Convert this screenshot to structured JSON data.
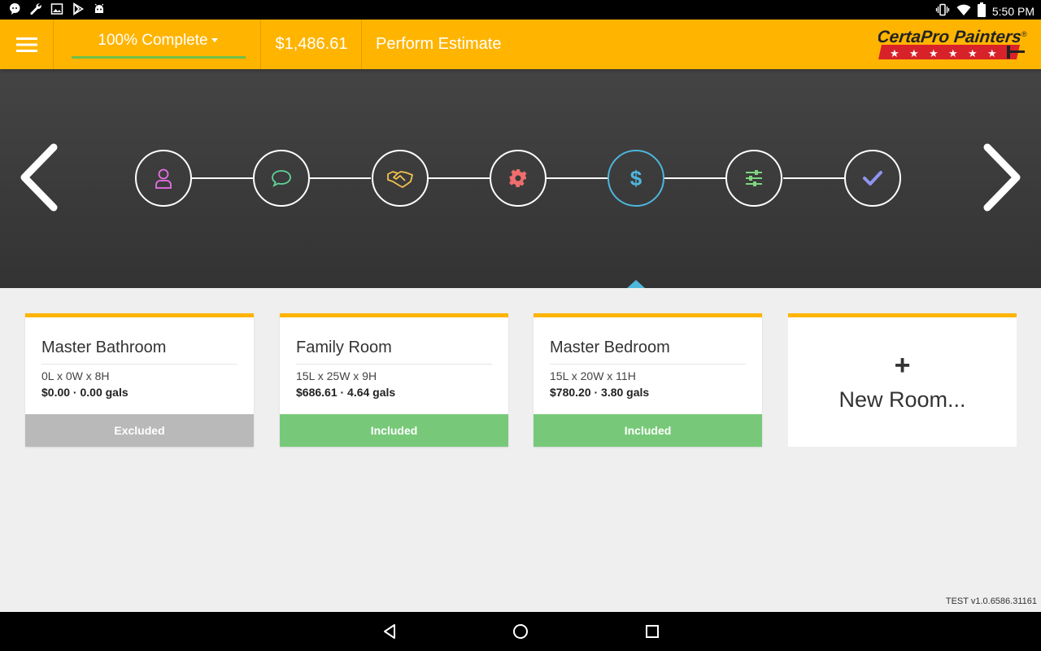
{
  "status_bar": {
    "time": "5:50 PM",
    "left_icons": [
      "chat-bubble-icon",
      "wrench-icon",
      "image-icon",
      "play-store-icon",
      "android-icon"
    ],
    "right_icons": [
      "vibrate-icon",
      "wifi-icon",
      "battery-icon"
    ]
  },
  "header": {
    "menu_icon": "hamburger-menu-icon",
    "progress_label": "100% Complete",
    "progress_fraction": 1.0,
    "total": "$1,486.61",
    "title": "Perform Estimate",
    "logo_text": "CertaPro Painters",
    "logo_mark": "®"
  },
  "stepper": {
    "prev_icon": "chevron-left-icon",
    "next_icon": "chevron-right-icon",
    "steps": [
      {
        "icon": "user-icon",
        "color": "#e86fe6"
      },
      {
        "icon": "speech-bubble-icon",
        "color": "#5fd39a"
      },
      {
        "icon": "handshake-icon",
        "color": "#f2c14e"
      },
      {
        "icon": "gear-icon",
        "color": "#ef6d6d"
      },
      {
        "icon": "dollar-icon",
        "color": "#4fb6dc",
        "active": true
      },
      {
        "icon": "sliders-icon",
        "color": "#7ed67e"
      },
      {
        "icon": "checkmark-icon",
        "color": "#8f94f0"
      }
    ]
  },
  "rooms": [
    {
      "name": "Master Bathroom",
      "dims": "0L x 0W x 8H",
      "cost": "$0.00 · 0.00 gals",
      "status": "Excluded"
    },
    {
      "name": "Family Room",
      "dims": "15L x 25W x 9H",
      "cost": "$686.61 · 4.64 gals",
      "status": "Included"
    },
    {
      "name": "Master Bedroom",
      "dims": "15L x 20W x 11H",
      "cost": "$780.20 · 3.80 gals",
      "status": "Included"
    }
  ],
  "new_room": {
    "plus": "+",
    "label": "New Room..."
  },
  "version": "TEST v1.0.6586.31161",
  "nav_bar": {
    "icons": [
      "back-triangle-icon",
      "home-circle-icon",
      "recents-square-icon"
    ]
  }
}
